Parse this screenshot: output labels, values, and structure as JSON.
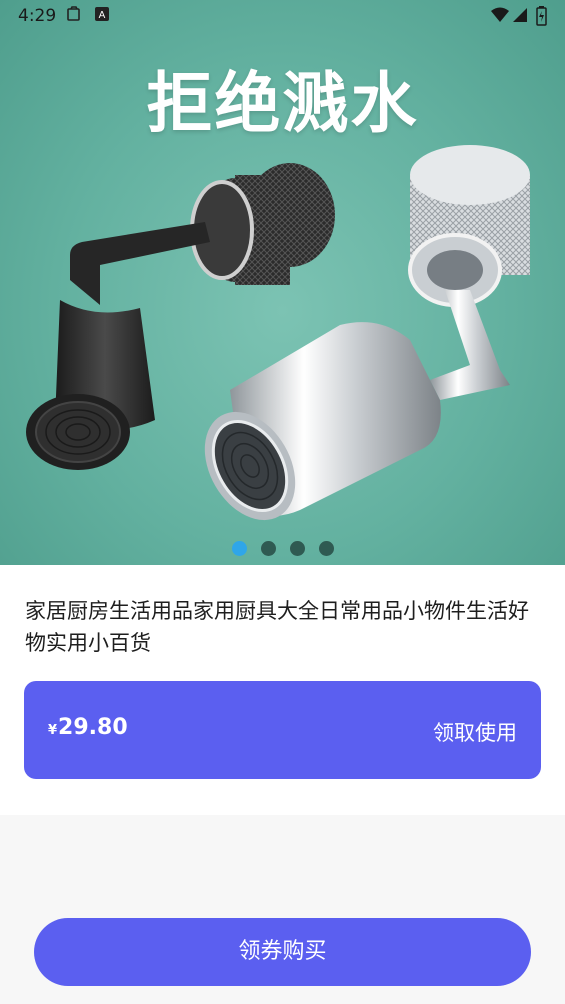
{
  "status_bar": {
    "time": "4:29",
    "icons": [
      "clipboard-icon",
      "font-a-icon",
      "wifi-icon",
      "signal-icon",
      "battery-icon"
    ]
  },
  "banner": {
    "title": "拒绝溅水",
    "page_count": 4,
    "active_index": 0,
    "accent_color": "#2fa6e9"
  },
  "product": {
    "title": "家居厨房生活用品家用厨具大全日常用品小物件生活好物实用小百货"
  },
  "coupon": {
    "currency": "¥",
    "price": "29.80",
    "action_label": "领取使用",
    "color": "#5b5ff0"
  },
  "footer": {
    "buy_label": "领券购买"
  }
}
